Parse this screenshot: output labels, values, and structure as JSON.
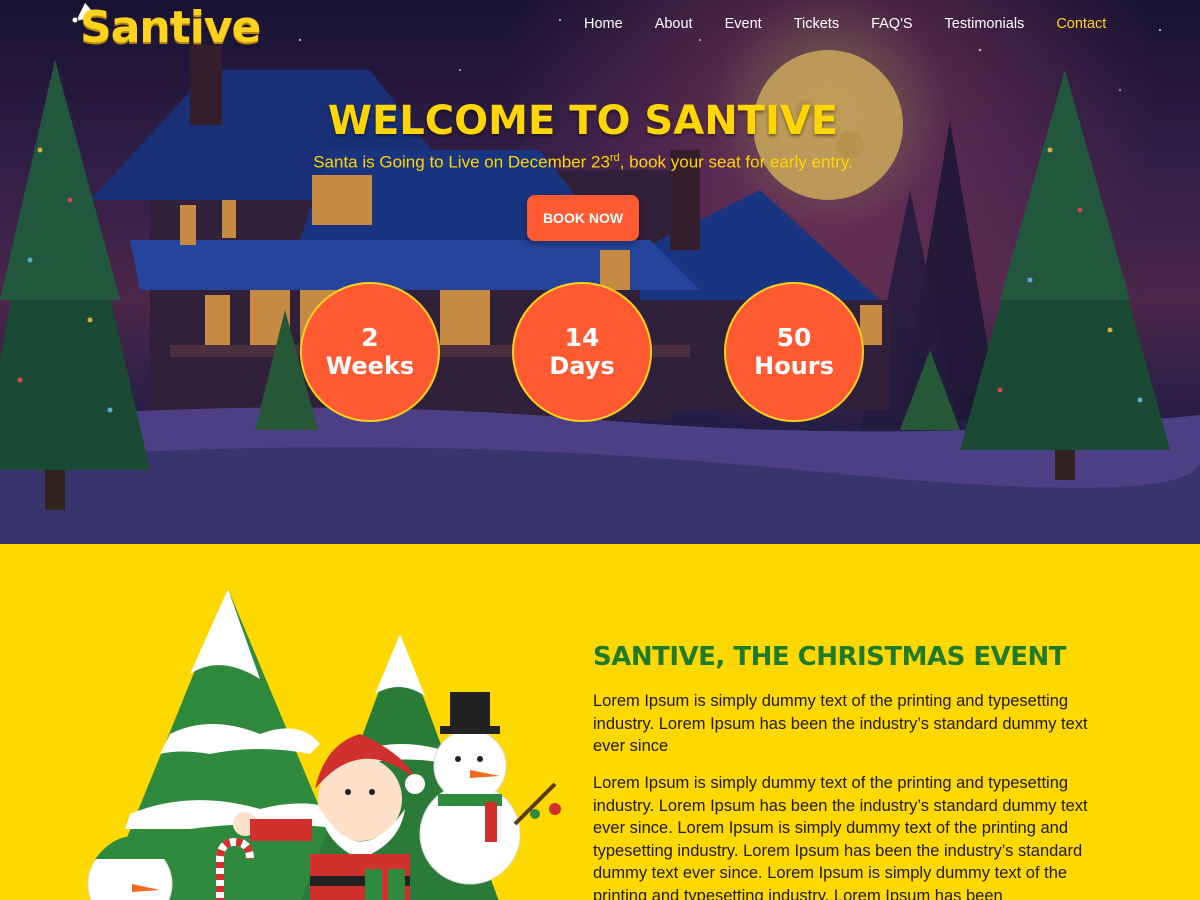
{
  "brand": {
    "name": "Santive"
  },
  "nav": {
    "items": [
      {
        "label": "Home"
      },
      {
        "label": "About"
      },
      {
        "label": "Event"
      },
      {
        "label": "Tickets"
      },
      {
        "label": "FAQ'S"
      },
      {
        "label": "Testimonials"
      },
      {
        "label": "Contact",
        "active": true
      }
    ]
  },
  "hero": {
    "title": "WELCOME TO SANTIVE",
    "subtitle_pre": "Santa is Going to Live on December 23",
    "subtitle_sup": "rd",
    "subtitle_post": ", book your seat for early entry.",
    "button": "BOOK NOW",
    "countdown": [
      {
        "value": "2",
        "unit": "Weeks"
      },
      {
        "value": "14",
        "unit": "Days"
      },
      {
        "value": "50",
        "unit": "Hours"
      }
    ]
  },
  "about": {
    "title": "SANTIVE, THE CHRISTMAS EVENT",
    "paragraph1": "Lorem Ipsum is simply dummy text of the printing and typesetting industry. Lorem Ipsum has been the industry’s standard dummy text ever since",
    "paragraph2": "Lorem Ipsum is simply dummy text of the printing and typesetting industry. Lorem Ipsum has been the industry’s standard dummy text ever since. Lorem Ipsum is simply dummy text of the printing and typesetting industry. Lorem Ipsum has been the industry’s standard dummy text ever since. Lorem Ipsum is simply dummy text of the printing and typesetting industry. Lorem Ipsum has been"
  },
  "colors": {
    "accent_yellow": "#ffd800",
    "button_orange": "#ff5a32",
    "title_green": "#1f7a2a",
    "nav_active": "#ffd21e"
  },
  "icons": [
    "santa-hat-icon"
  ]
}
